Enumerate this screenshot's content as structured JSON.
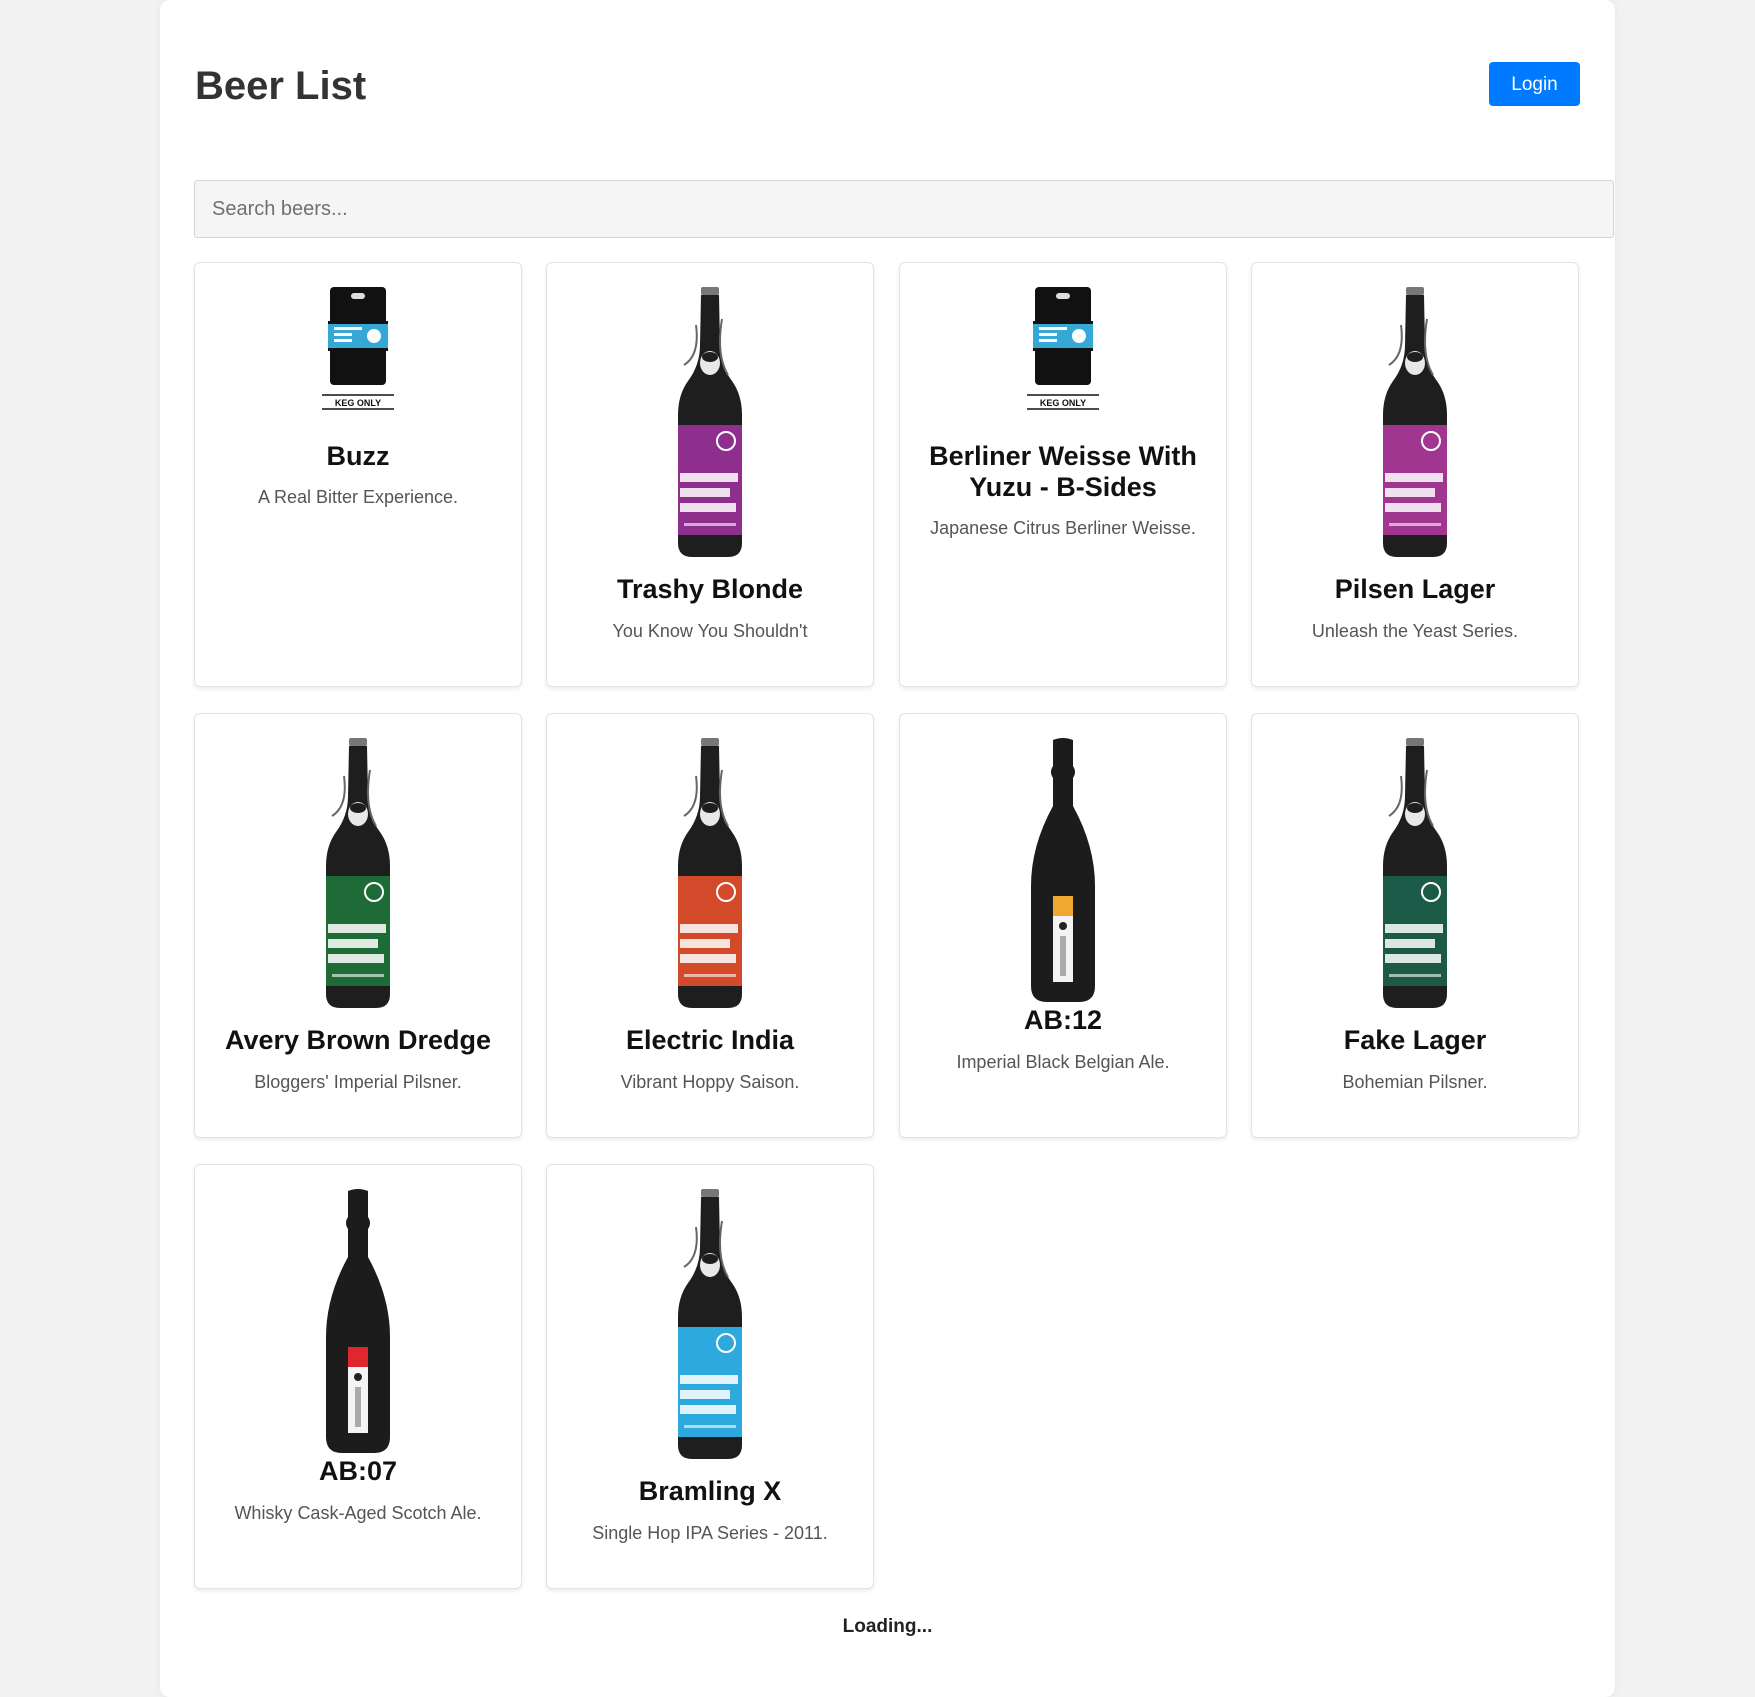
{
  "header": {
    "title": "Beer List",
    "login_label": "Login"
  },
  "search": {
    "placeholder": "Search beers...",
    "value": ""
  },
  "beers": [
    {
      "name": "Buzz",
      "tagline": "A Real Bitter Experience.",
      "image": "keg-icon",
      "label_color": "#35a8d6",
      "keg_text": "KEG ONLY"
    },
    {
      "name": "Trashy Blonde",
      "tagline": "You Know You Shouldn't",
      "image": "bottle-icon",
      "label_color": "#8e2f8e"
    },
    {
      "name": "Berliner Weisse With Yuzu - B-Sides",
      "tagline": "Japanese Citrus Berliner Weisse.",
      "image": "keg-icon",
      "label_color": "#35a8d6",
      "keg_text": "KEG ONLY"
    },
    {
      "name": "Pilsen Lager",
      "tagline": "Unleash the Yeast Series.",
      "image": "bottle-icon",
      "label_color": "#a0368f"
    },
    {
      "name": "Avery Brown Dredge",
      "tagline": "Bloggers' Imperial Pilsner.",
      "image": "bottle-icon",
      "label_color": "#1e6b38"
    },
    {
      "name": "Electric India",
      "tagline": "Vibrant Hoppy Saison.",
      "image": "bottle-icon",
      "label_color": "#d24a2a"
    },
    {
      "name": "AB:12",
      "tagline": "Imperial Black Belgian Ale.",
      "image": "tall-bottle-icon",
      "label_color": "#f0a833"
    },
    {
      "name": "Fake Lager",
      "tagline": "Bohemian Pilsner.",
      "image": "bottle-icon",
      "label_color": "#1a5a46"
    },
    {
      "name": "AB:07",
      "tagline": "Whisky Cask-Aged Scotch Ale.",
      "image": "tall-bottle-icon",
      "label_color": "#e0272f"
    },
    {
      "name": "Bramling X",
      "tagline": "Single Hop IPA Series - 2011.",
      "image": "bottle-icon",
      "label_color": "#2ea9dd"
    }
  ],
  "status": {
    "loading_text": "Loading..."
  }
}
